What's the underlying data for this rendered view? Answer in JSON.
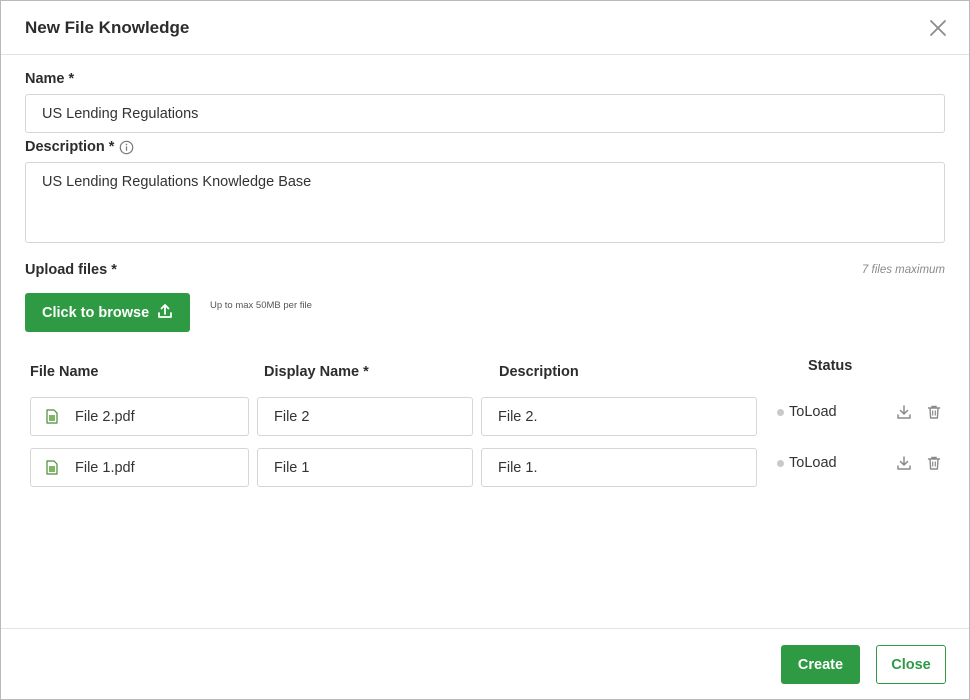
{
  "dialog": {
    "title": "New File Knowledge"
  },
  "form": {
    "name_label": "Name *",
    "name_value": "US Lending Regulations",
    "description_label": "Description *",
    "description_value": "US Lending Regulations Knowledge Base",
    "upload_label": "Upload files *",
    "files_max": "7 files maximum",
    "browse_label": "Click to browse",
    "size_hint": "Up to max 50MB per file"
  },
  "table": {
    "headers": {
      "file_name": "File Name",
      "display_name": "Display Name *",
      "description": "Description",
      "status": "Status"
    },
    "rows": [
      {
        "file_name": "File 2.pdf",
        "display_name": "File 2",
        "description": "File 2.",
        "status": "ToLoad"
      },
      {
        "file_name": "File 1.pdf",
        "display_name": "File 1",
        "description": "File 1.",
        "status": "ToLoad"
      }
    ]
  },
  "footer": {
    "create_label": "Create",
    "close_label": "Close"
  },
  "colors": {
    "accent": "#2f9a44",
    "status_dot": "#c9c9c9"
  },
  "icons": {
    "close": "close-icon",
    "info": "info-icon",
    "upload": "upload-icon",
    "file": "file-icon",
    "download": "download-icon",
    "delete": "trash-icon"
  }
}
